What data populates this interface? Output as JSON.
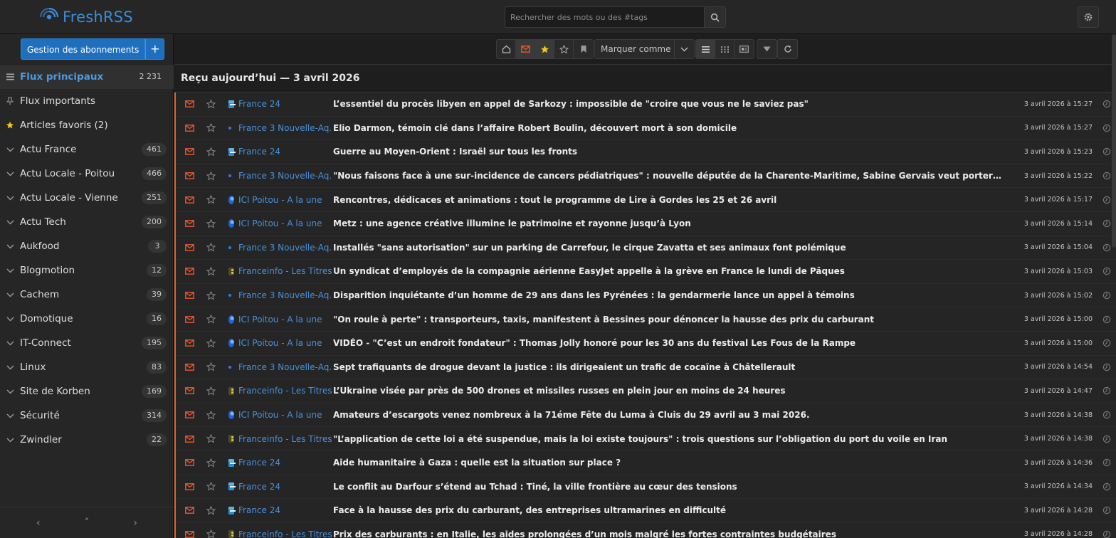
{
  "app": {
    "name": "FreshRSS"
  },
  "search": {
    "placeholder": "Rechercher des mots ou des #tags"
  },
  "sidebar": {
    "manage_label": "Gestion des abonnements",
    "manage_plus": "+",
    "items": [
      {
        "label": "Flux principaux",
        "count": "2 231",
        "icon": "list-icon",
        "active": true
      },
      {
        "label": "Flux importants",
        "count": "",
        "icon": "pin-icon"
      },
      {
        "label": "Articles favoris (2)",
        "count": "",
        "icon": "star-icon"
      },
      {
        "label": "Actu France",
        "count": "461",
        "icon": "chevron-down-icon"
      },
      {
        "label": "Actu Locale - Poitou",
        "count": "466",
        "icon": "chevron-down-icon"
      },
      {
        "label": "Actu Locale - Vienne",
        "count": "251",
        "icon": "chevron-down-icon"
      },
      {
        "label": "Actu Tech",
        "count": "200",
        "icon": "chevron-down-icon"
      },
      {
        "label": "Aukfood",
        "count": "3",
        "icon": "chevron-down-icon"
      },
      {
        "label": "Blogmotion",
        "count": "12",
        "icon": "chevron-down-icon"
      },
      {
        "label": "Cachem",
        "count": "39",
        "icon": "chevron-down-icon"
      },
      {
        "label": "Domotique",
        "count": "16",
        "icon": "chevron-down-icon"
      },
      {
        "label": "IT-Connect",
        "count": "195",
        "icon": "chevron-down-icon"
      },
      {
        "label": "Linux",
        "count": "83",
        "icon": "chevron-down-icon"
      },
      {
        "label": "Site de Korben",
        "count": "169",
        "icon": "chevron-down-icon"
      },
      {
        "label": "Sécurité",
        "count": "314",
        "icon": "chevron-down-icon"
      },
      {
        "label": "Zwindler",
        "count": "22",
        "icon": "chevron-down-icon"
      }
    ]
  },
  "toolbar": {
    "mark_read_label": "Marquer comme lu"
  },
  "header": {
    "title": "Reçu aujourd’hui — 3 avril 2026"
  },
  "colors": {
    "accent": "#3b8ddb",
    "unread_bar": "#e0622d",
    "button": "#1f6fbf"
  },
  "articles": [
    {
      "feed": "France 24",
      "feed_icon": "f24",
      "title": "L’essentiel du procès libyen en appel de Sarkozy : impossible de \"croire que vous ne le saviez pas\"",
      "date": "3 avril 2026 à 15:27"
    },
    {
      "feed": "France 3 Nouvelle-Aq...",
      "feed_icon": "f3",
      "title": "Elio Darmon, témoin clé dans l’affaire Robert Boulin, découvert mort à son domicile",
      "date": "3 avril 2026 à 15:27"
    },
    {
      "feed": "France 24",
      "feed_icon": "f24",
      "title": "Guerre au Moyen-Orient : Israël sur tous les fronts",
      "date": "3 avril 2026 à 15:23"
    },
    {
      "feed": "France 3 Nouvelle-Aq...",
      "feed_icon": "f3",
      "title": "\"Nous faisons face à une sur-incidence de cancers pédiatriques\" : nouvelle députée de la Charente-Maritime, Sabine Gervais veut porter la cause de la santé ...",
      "date": "3 avril 2026 à 15:22"
    },
    {
      "feed": "ICI Poitou - A la une",
      "feed_icon": "ici",
      "title": "Rencontres, dédicaces et animations : tout le programme de Lire à Gordes les 25 et 26 avril",
      "date": "3 avril 2026 à 15:17"
    },
    {
      "feed": "ICI Poitou - A la une",
      "feed_icon": "ici",
      "title": "Metz : une agence créative illumine le patrimoine et rayonne jusqu’à Lyon",
      "date": "3 avril 2026 à 15:14"
    },
    {
      "feed": "France 3 Nouvelle-Aq...",
      "feed_icon": "f3",
      "title": "Installés \"sans autorisation\" sur un parking de Carrefour, le cirque Zavatta et ses animaux font polémique",
      "date": "3 avril 2026 à 15:04"
    },
    {
      "feed": "Franceinfo - Les Titres",
      "feed_icon": "finfo",
      "title": "Un syndicat d’employés de la compagnie aérienne EasyJet appelle à la grève en France le lundi de Pâques",
      "date": "3 avril 2026 à 15:03"
    },
    {
      "feed": "France 3 Nouvelle-Aq...",
      "feed_icon": "f3",
      "title": "Disparition inquiétante d’un homme de 29 ans dans les Pyrénées : la gendarmerie lance un appel à témoins",
      "date": "3 avril 2026 à 15:02"
    },
    {
      "feed": "ICI Poitou - A la une",
      "feed_icon": "ici",
      "title": "\"On roule à perte\" : transporteurs, taxis, manifestent à Bessines pour dénoncer la hausse des prix du carburant",
      "date": "3 avril 2026 à 15:00"
    },
    {
      "feed": "ICI Poitou - A la une",
      "feed_icon": "ici",
      "title": "VIDÉO - \"C’est un endroit fondateur\" : Thomas Jolly honoré pour les 30 ans du festival Les Fous de la Rampe",
      "date": "3 avril 2026 à 15:00"
    },
    {
      "feed": "France 3 Nouvelle-Aq...",
      "feed_icon": "f3",
      "title": "Sept trafiquants de drogue devant la justice : ils dirigeaient un trafic de cocaïne à Châtellerault",
      "date": "3 avril 2026 à 14:54"
    },
    {
      "feed": "Franceinfo - Les Titres",
      "feed_icon": "finfo",
      "title": "L’Ukraine visée par près de 500 drones et missiles russes en plein jour en moins de 24 heures",
      "date": "3 avril 2026 à 14:47"
    },
    {
      "feed": "ICI Poitou - A la une",
      "feed_icon": "ici",
      "title": "Amateurs d’escargots venez nombreux à la 71éme Fête du Luma à Cluis du 29 avril au 3 mai 2026.",
      "date": "3 avril 2026 à 14:38"
    },
    {
      "feed": "Franceinfo - Les Titres",
      "feed_icon": "finfo",
      "title": "\"L’application de cette loi a été suspendue, mais la loi existe toujours\" : trois questions sur l’obligation du port du voile en Iran",
      "date": "3 avril 2026 à 14:38"
    },
    {
      "feed": "France 24",
      "feed_icon": "f24",
      "title": "Aide humanitaire à Gaza : quelle est la situation sur place ?",
      "date": "3 avril 2026 à 14:36"
    },
    {
      "feed": "France 24",
      "feed_icon": "f24",
      "title": "Le conflit au Darfour s’étend au Tchad : Tiné, la ville frontière au cœur des tensions",
      "date": "3 avril 2026 à 14:34"
    },
    {
      "feed": "France 24",
      "feed_icon": "f24",
      "title": "Face à la hausse des prix du carburant, des entreprises ultramarines en difficulté",
      "date": "3 avril 2026 à 14:28"
    },
    {
      "feed": "Franceinfo - Les Titres",
      "feed_icon": "finfo",
      "title": "Prix des carburants : en Italie, les aides prolongées d’un mois malgré les fortes contraintes budgétaires",
      "date": "3 avril 2026 à 14:28"
    }
  ]
}
